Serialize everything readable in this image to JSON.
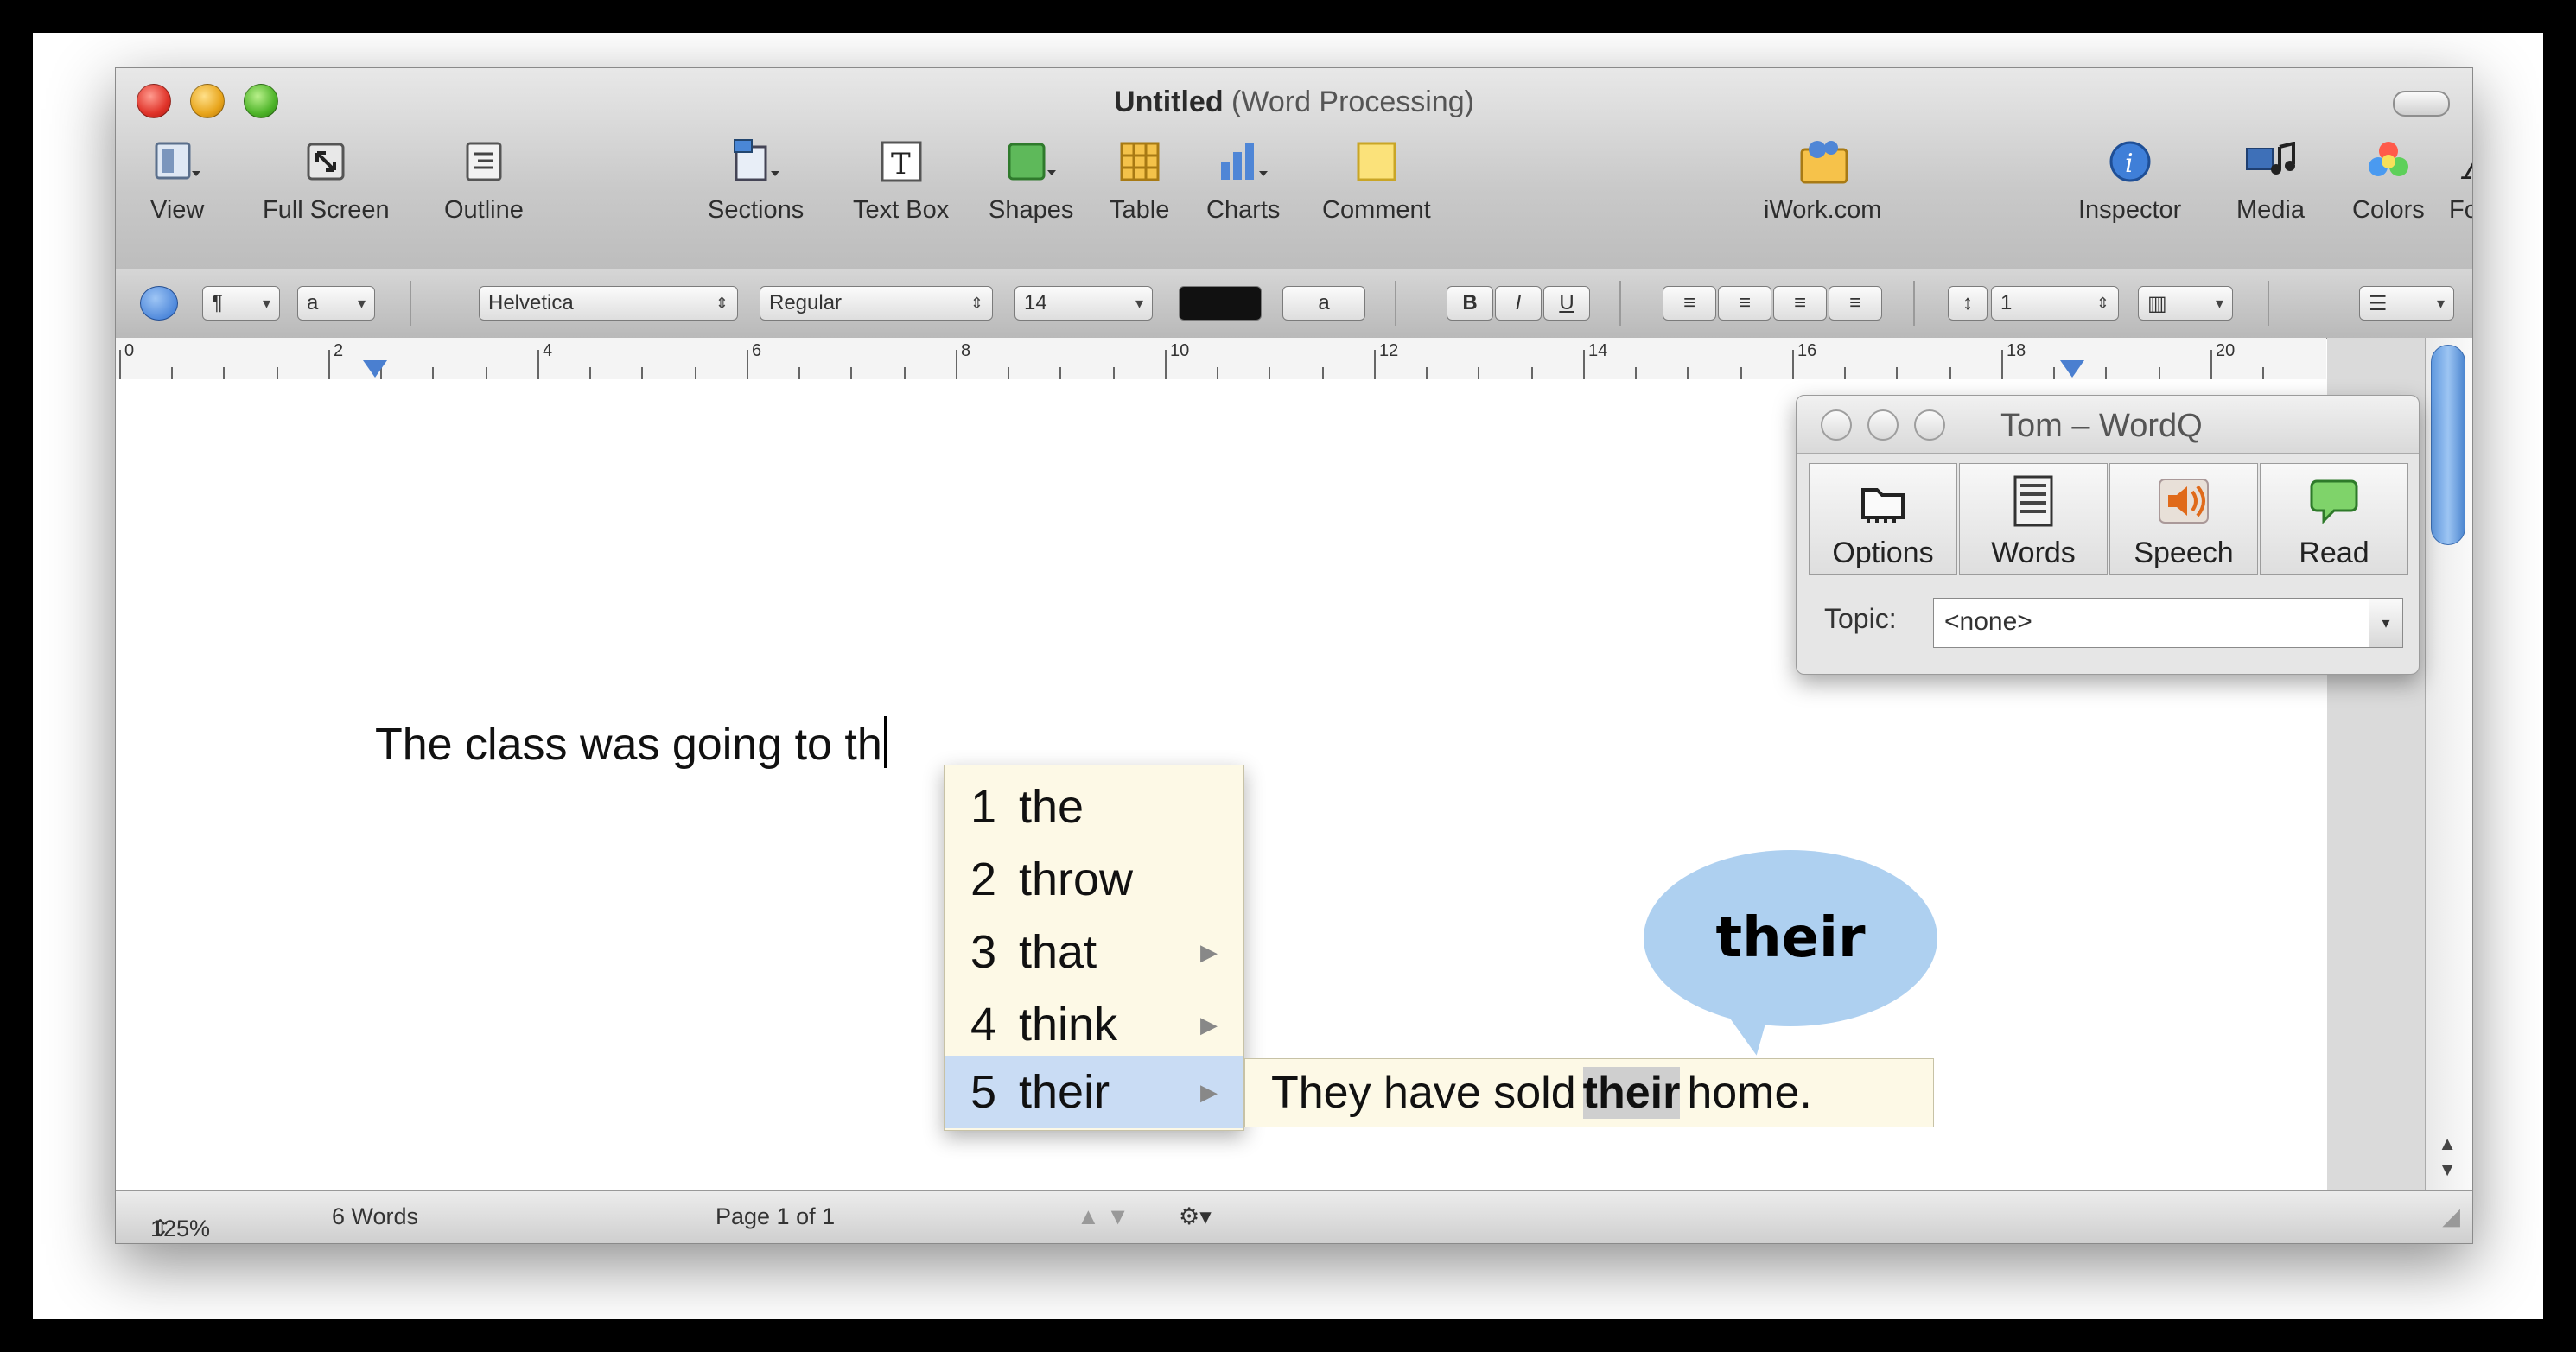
{
  "window": {
    "title_bold": "Untitled",
    "title_rest": "(Word Processing)"
  },
  "toolbar": {
    "items": [
      {
        "label": "View",
        "icon": "view-icon"
      },
      {
        "label": "Full Screen",
        "icon": "full-screen-icon"
      },
      {
        "label": "Outline",
        "icon": "outline-icon"
      },
      {
        "label": "Sections",
        "icon": "sections-icon"
      },
      {
        "label": "Text Box",
        "icon": "text-box-icon"
      },
      {
        "label": "Shapes",
        "icon": "shapes-icon"
      },
      {
        "label": "Table",
        "icon": "table-icon"
      },
      {
        "label": "Charts",
        "icon": "charts-icon"
      },
      {
        "label": "Comment",
        "icon": "comment-icon"
      },
      {
        "label": "iWork.com",
        "icon": "iwork-icon"
      },
      {
        "label": "Inspector",
        "icon": "inspector-icon"
      },
      {
        "label": "Media",
        "icon": "media-icon"
      },
      {
        "label": "Colors",
        "icon": "colors-icon"
      },
      {
        "label": "Fonts",
        "icon": "fonts-icon"
      }
    ]
  },
  "format": {
    "paragraph_style": "¶",
    "char_style": "a",
    "font_family": "Helvetica",
    "font_style": "Regular",
    "font_size": "14",
    "text_color": "#111111",
    "bg_color_glyph": "a",
    "bold": "B",
    "italic": "I",
    "underline": "U",
    "line_spacing": "1"
  },
  "ruler": {
    "numbers": [
      "0",
      "2",
      "4",
      "6",
      "8",
      "10",
      "12",
      "14",
      "16",
      "18",
      "20"
    ]
  },
  "document": {
    "text": "The class was going to th"
  },
  "status": {
    "zoom": "125%",
    "word_count": "6 Words",
    "page": "Page 1 of 1"
  },
  "wordq": {
    "title": "Tom – WordQ",
    "buttons": [
      {
        "label": "Options",
        "icon": "options-icon"
      },
      {
        "label": "Words",
        "icon": "words-list-icon"
      },
      {
        "label": "Speech",
        "icon": "speaker-icon"
      },
      {
        "label": "Read",
        "icon": "speech-bubble-icon"
      }
    ],
    "topic_label": "Topic:",
    "topic_value": "<none>"
  },
  "predictions": {
    "items": [
      {
        "num": "1",
        "word": "the"
      },
      {
        "num": "2",
        "word": "throw"
      },
      {
        "num": "3",
        "word": "that"
      },
      {
        "num": "4",
        "word": "think"
      },
      {
        "num": "5",
        "word": "their"
      }
    ],
    "selected_index": 4
  },
  "example": {
    "before": "They have sold",
    "highlight": "their",
    "after": "home."
  },
  "bubble": {
    "word": "their"
  },
  "colors": {
    "selection": "#c9dcf4",
    "prediction_bg": "#fdf9e6",
    "bubble": "#aed0f0",
    "scroll_thumb": "#5f98de"
  }
}
